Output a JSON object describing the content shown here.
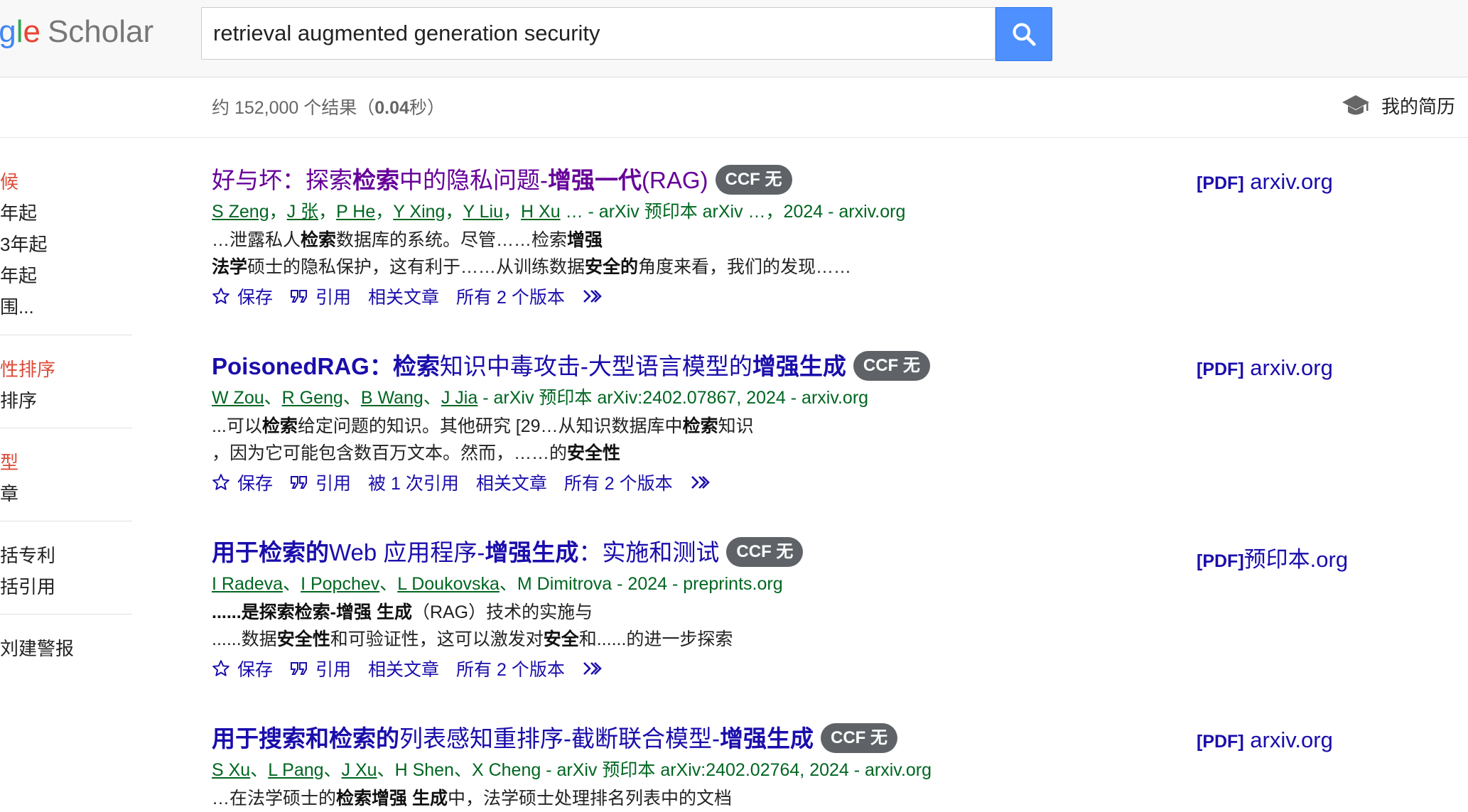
{
  "header": {
    "logo_letters": [
      "g",
      "l",
      "e"
    ],
    "logo_brand": "Scholar",
    "search_value": "retrieval augmented generation security",
    "search_icon": "search-icon",
    "accent_color": "#4d90fe"
  },
  "stats": {
    "prefix": "约 152,000 个结果（",
    "time": "0.04",
    "suffix": "秒）"
  },
  "profile": {
    "label": "我的简历",
    "icon": "graduation-cap-icon"
  },
  "sidebar": {
    "items": [
      {
        "label": "候",
        "color": "red"
      },
      {
        "label": "年起",
        "color": "normal"
      },
      {
        "label": "3年起",
        "color": "normal"
      },
      {
        "label": "年起",
        "color": "normal"
      },
      {
        "label": "围...",
        "color": "normal"
      },
      {
        "label": "性排序",
        "color": "red"
      },
      {
        "label": "排序",
        "color": "normal"
      },
      {
        "label": "型",
        "color": "red"
      },
      {
        "label": "章",
        "color": "normal"
      },
      {
        "label": "括专利",
        "color": "normal"
      },
      {
        "label": "括引用",
        "color": "normal"
      },
      {
        "label": "刘建警报",
        "color": "normal"
      }
    ]
  },
  "results": [
    {
      "title_parts": [
        {
          "text": "好与坏：探索",
          "b": false
        },
        {
          "text": "检索",
          "b": true
        },
        {
          "text": "中的隐私问题-",
          "b": false
        },
        {
          "text": "增强一代",
          "b": true
        },
        {
          "text": "(RAG)",
          "b": false
        }
      ],
      "visited": true,
      "badge": "CCF 无",
      "authors": [
        "S Zeng",
        "J 张",
        "P He",
        "Y Xing",
        "Y Liu",
        "H Xu"
      ],
      "author_sep": "，",
      "venue": " … - arXiv 预印本 arXiv …，2024 - arxiv.org",
      "snippet_lines": [
        [
          {
            "text": "…泄露私人",
            "b": false
          },
          {
            "text": "检索",
            "b": true
          },
          {
            "text": "数据库的系统。尽管……检索",
            "b": false
          },
          {
            "text": "增强",
            "b": true
          }
        ],
        [
          {
            "text": "法学",
            "b": true
          },
          {
            "text": "硕士的隐私保护，这有利于……从训练数据",
            "b": false
          },
          {
            "text": "安全的",
            "b": true
          },
          {
            "text": "角度来看，我们的发现……",
            "b": false
          }
        ]
      ],
      "actions": {
        "save": "保存",
        "cite": "引用",
        "cited_by": "",
        "related": "相关文章",
        "versions": "所有 2 个版本"
      },
      "pdf_tag": "[PDF]",
      "pdf_domain": " arxiv.org",
      "pdf_visited": false
    },
    {
      "title_parts": [
        {
          "text": "PoisonedRAG：",
          "b": true
        },
        {
          "text": "检索",
          "b": true
        },
        {
          "text": "知识中毒攻击-大型语言模型的",
          "b": false
        },
        {
          "text": "增强生成",
          "b": true
        }
      ],
      "visited": false,
      "badge": "CCF 无",
      "authors": [
        "W Zou",
        "R Geng",
        "B Wang",
        "J Jia"
      ],
      "author_sep": "、",
      "venue": " - arXiv 预印本 arXiv:2402.07867, 2024 - arxiv.org",
      "snippet_lines": [
        [
          {
            "text": "...可以",
            "b": false
          },
          {
            "text": "检索",
            "b": true
          },
          {
            "text": "给定问题的知识。其他研究 [29…从知识数据库中",
            "b": false
          },
          {
            "text": "检索",
            "b": true
          },
          {
            "text": "知识",
            "b": false
          }
        ],
        [
          {
            "text": "，因为它可能包含数百万文本。然而，……的",
            "b": false
          },
          {
            "text": "安全性",
            "b": true
          }
        ]
      ],
      "actions": {
        "save": "保存",
        "cite": "引用",
        "cited_by": "被 1 次引用",
        "related": "相关文章",
        "versions": "所有 2 个版本"
      },
      "pdf_tag": "[PDF]",
      "pdf_domain": " arxiv.org",
      "pdf_visited": false
    },
    {
      "title_parts": [
        {
          "text": "用于检索的",
          "b": true
        },
        {
          "text": "Web 应用程序-",
          "b": false
        },
        {
          "text": "增强生成",
          "b": true
        },
        {
          "text": "：实施和测试",
          "b": false
        }
      ],
      "visited": false,
      "badge": "CCF 无",
      "authors": [
        "I Radeva",
        "I Popchev",
        "L Doukovska"
      ],
      "author_sep": "、",
      "venue": "、M Dimitrova - 2024 - preprints.org",
      "snippet_lines": [
        [
          {
            "text": "......是探索检索-增强 生成",
            "b": true
          },
          {
            "text": "（RAG）技术的实施与",
            "b": false
          }
        ],
        [
          {
            "text": "......数据",
            "b": false
          },
          {
            "text": "安全性",
            "b": true
          },
          {
            "text": "和可验证性，这可以激发对",
            "b": false
          },
          {
            "text": "安全",
            "b": true
          },
          {
            "text": "和......的进一步探索",
            "b": false
          }
        ]
      ],
      "actions": {
        "save": "保存",
        "cite": "引用",
        "cited_by": "",
        "related": "相关文章",
        "versions": "所有 2 个版本"
      },
      "pdf_tag": "[PDF]",
      "pdf_domain": "预印本.org",
      "pdf_visited": false
    },
    {
      "title_parts": [
        {
          "text": "用于搜索和检索的",
          "b": true
        },
        {
          "text": "列表感知重排序-截断联合模型-",
          "b": false
        },
        {
          "text": "增强生成",
          "b": true
        }
      ],
      "visited": false,
      "badge": "CCF 无",
      "authors": [
        "S Xu",
        "L Pang",
        "J Xu"
      ],
      "author_sep": "、",
      "venue": "、H Shen、X Cheng - arXiv 预印本 arXiv:2402.02764, 2024 - arxiv.org",
      "snippet_lines": [
        [
          {
            "text": "…在法学硕士的",
            "b": false
          },
          {
            "text": "检索增强 生成",
            "b": true
          },
          {
            "text": "中，法学硕士处理排名列表中的文档",
            "b": false
          }
        ]
      ],
      "actions": null,
      "pdf_tag": "[PDF]",
      "pdf_domain": " arxiv.org",
      "pdf_visited": false
    }
  ]
}
